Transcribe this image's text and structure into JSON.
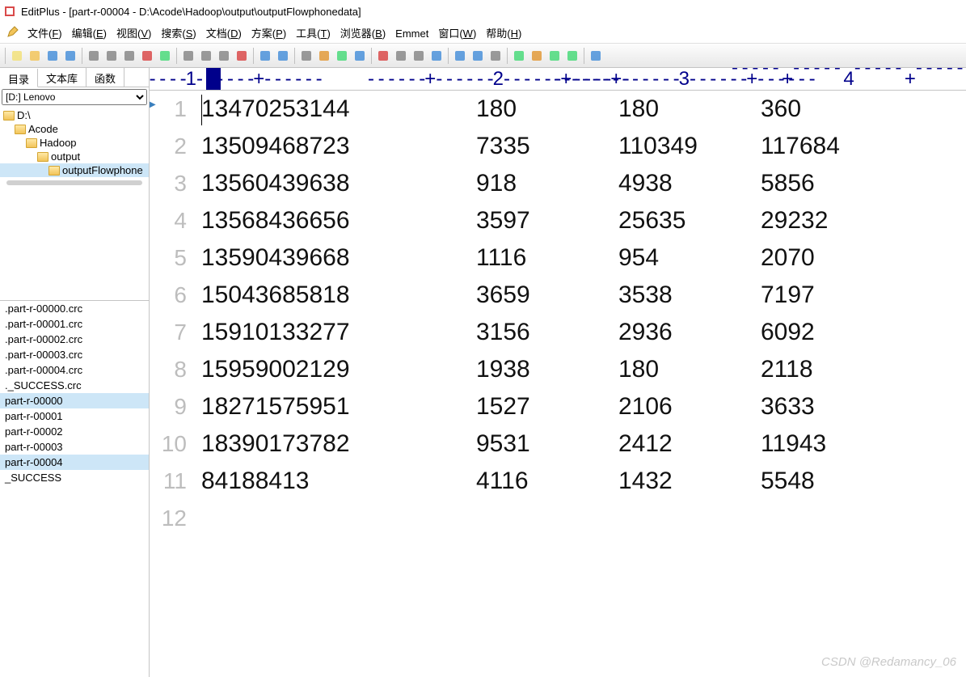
{
  "app": {
    "name": "EditPlus",
    "doc": "part-r-00004",
    "path": "D:\\Acode\\Hadoop\\output\\outputFlowphonedata"
  },
  "menus": [
    {
      "label": "文件",
      "key": "F"
    },
    {
      "label": "编辑",
      "key": "E"
    },
    {
      "label": "视图",
      "key": "V"
    },
    {
      "label": "搜索",
      "key": "S"
    },
    {
      "label": "文档",
      "key": "D"
    },
    {
      "label": "方案",
      "key": "P"
    },
    {
      "label": "工具",
      "key": "T"
    },
    {
      "label": "浏览器",
      "key": "B"
    },
    {
      "label": "Emmet",
      "key": ""
    },
    {
      "label": "窗口",
      "key": "W"
    },
    {
      "label": "帮助",
      "key": "H"
    }
  ],
  "sidebar": {
    "tabs": [
      "目录",
      "文本库",
      "函数"
    ],
    "drive": "[D:] Lenovo",
    "tree": [
      {
        "label": "D:\\",
        "indent": 0
      },
      {
        "label": "Acode",
        "indent": 1
      },
      {
        "label": "Hadoop",
        "indent": 2
      },
      {
        "label": "output",
        "indent": 3
      },
      {
        "label": "outputFlowphone",
        "indent": 4,
        "selected": true
      }
    ],
    "files": [
      ".part-r-00000.crc",
      ".part-r-00001.crc",
      ".part-r-00002.crc",
      ".part-r-00003.crc",
      ".part-r-00004.crc",
      "._SUCCESS.crc",
      "part-r-00000",
      "part-r-00001",
      "part-r-00002",
      "part-r-00003",
      "part-r-00004",
      "_SUCCESS"
    ],
    "selected_file": "part-r-00004",
    "highlighted_file": "part-r-00000"
  },
  "ruler": {
    "marks": [
      "1",
      "2",
      "3",
      "4"
    ]
  },
  "lines": [
    {
      "n": "1",
      "c1": "13470253144",
      "c2": "180",
      "c3": "180",
      "c4": "360"
    },
    {
      "n": "2",
      "c1": "13509468723",
      "c2": "7335",
      "c3": "110349",
      "c4": "117684"
    },
    {
      "n": "3",
      "c1": "13560439638",
      "c2": "918",
      "c3": "4938",
      "c4": "5856"
    },
    {
      "n": "4",
      "c1": "13568436656",
      "c2": "3597",
      "c3": "25635",
      "c4": "29232"
    },
    {
      "n": "5",
      "c1": "13590439668",
      "c2": "1116",
      "c3": "954",
      "c4": "2070"
    },
    {
      "n": "6",
      "c1": "15043685818",
      "c2": "3659",
      "c3": "3538",
      "c4": "7197"
    },
    {
      "n": "7",
      "c1": "15910133277",
      "c2": "3156",
      "c3": "2936",
      "c4": "6092"
    },
    {
      "n": "8",
      "c1": "15959002129",
      "c2": "1938",
      "c3": "180",
      "c4": "2118"
    },
    {
      "n": "9",
      "c1": "18271575951",
      "c2": "1527",
      "c3": "2106",
      "c4": "3633"
    },
    {
      "n": "10",
      "c1": "18390173782",
      "c2": "9531",
      "c3": "2412",
      "c4": "11943"
    },
    {
      "n": "11",
      "c1": "84188413",
      "c2": "4116",
      "c3": "1432",
      "c4": "5548"
    },
    {
      "n": "12",
      "c1": "",
      "c2": "",
      "c3": "",
      "c4": ""
    }
  ],
  "watermark": "CSDN @Redamancy_06",
  "icons": {
    "new": "#f2e07a",
    "open": "#f2c45a",
    "save": "#4a90d9",
    "saveall": "#4a90d9",
    "print": "#888",
    "spell": "#d94a4a",
    "cut": "#888",
    "copy": "#888",
    "paste": "#888",
    "delete": "#d94a4a",
    "undo": "#4a90d9",
    "redo": "#4a90d9",
    "find": "#888",
    "replace": "#e29a3a",
    "indent": "#4a90d9",
    "font": "#d94a4a",
    "hex": "#888",
    "wrap": "#4a90d9",
    "cols": "#4a90d9",
    "gear": "#888",
    "browser": "#4ad97a",
    "help": "#4a90d9"
  }
}
